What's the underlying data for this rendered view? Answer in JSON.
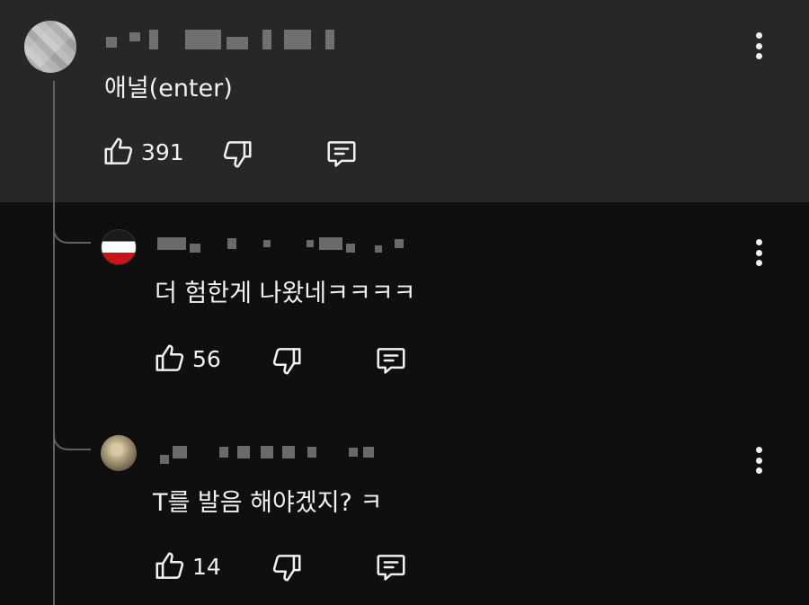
{
  "colors": {
    "background": "#0f0f0f",
    "highlighted_comment_bg": "#272727",
    "text": "#f1f1f1",
    "thread_line": "#606060"
  },
  "comments": [
    {
      "author": "",
      "avatar": "blurred-avatar",
      "text": "애널(enter)",
      "likes": "391",
      "highlighted": true
    },
    {
      "author": "",
      "avatar": "black-white-red-flag-avatar",
      "text": "더 험한게 나왔네ㅋㅋㅋㅋ",
      "likes": "56",
      "highlighted": false
    },
    {
      "author": "",
      "avatar": "moon-avatar",
      "text": "T를 발음 해야겠지? ㅋ",
      "likes": "14",
      "highlighted": false
    }
  ],
  "icons": {
    "like": "thumbs-up-icon",
    "dislike": "thumbs-down-icon",
    "reply": "reply-comment-icon",
    "more": "more-vertical-icon"
  }
}
